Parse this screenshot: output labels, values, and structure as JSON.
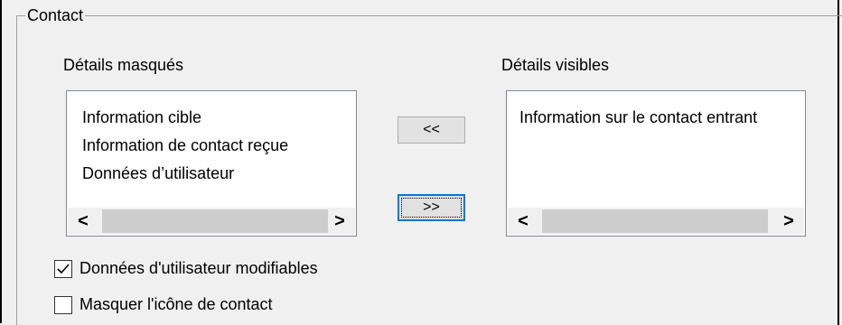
{
  "group": {
    "title": "Contact"
  },
  "hidden_details": {
    "label": "Détails masqués",
    "items": [
      {
        "label": "Information cible"
      },
      {
        "label": "Information de contact reçue"
      },
      {
        "label": "Données d’utilisateur"
      }
    ]
  },
  "visible_details": {
    "label": "Détails visibles",
    "items": [
      {
        "label": "Information sur le contact entrant"
      }
    ]
  },
  "buttons": {
    "move_left": "<<",
    "move_right": ">>"
  },
  "checkboxes": [
    {
      "label": "Données d'utilisateur modifiables",
      "checked": true
    },
    {
      "label": "Masquer l'icône de contact",
      "checked": false
    }
  ],
  "icons": {
    "scroll_left": "<",
    "scroll_right": ">"
  }
}
